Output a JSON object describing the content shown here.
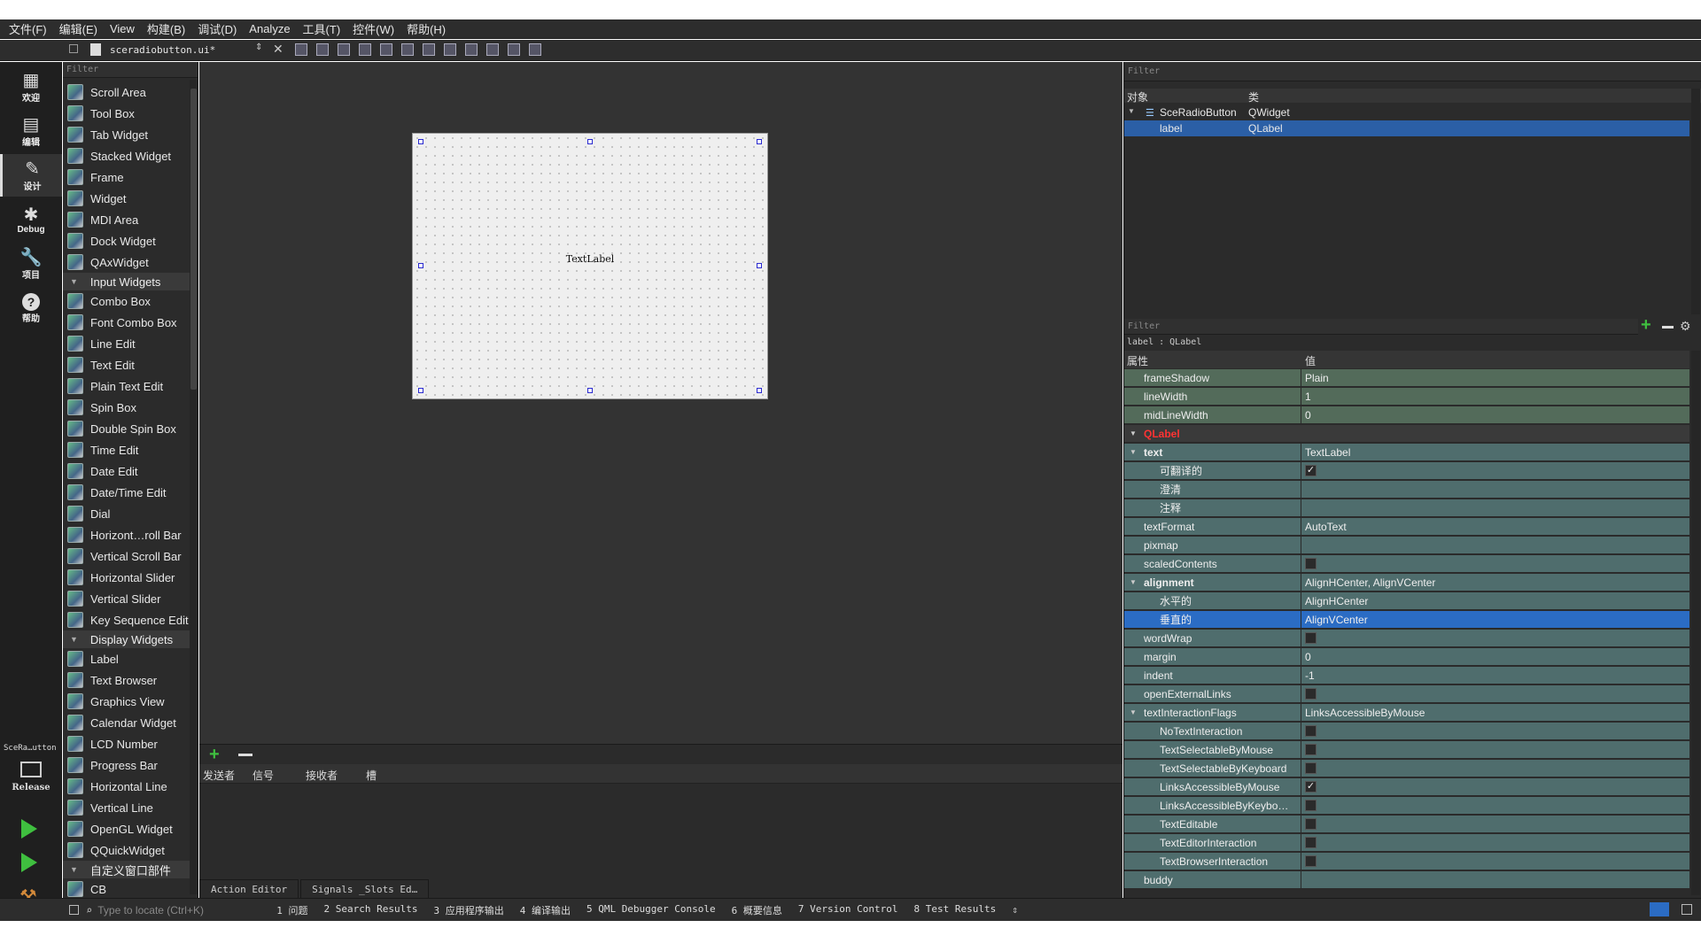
{
  "menu": [
    "文件(F)",
    "编辑(E)",
    "View",
    "构建(B)",
    "调试(D)",
    "Analyze",
    "工具(T)",
    "控件(W)",
    "帮助(H)"
  ],
  "toolbar": {
    "file_name": "sceradiobutton.ui*"
  },
  "modes": [
    {
      "label": "欢迎",
      "icon": "grid-icon"
    },
    {
      "label": "编辑",
      "icon": "edit-icon"
    },
    {
      "label": "设计",
      "icon": "pencil-icon"
    },
    {
      "label": "Debug",
      "icon": "bug-icon"
    },
    {
      "label": "项目",
      "icon": "wrench-icon"
    },
    {
      "label": "帮助",
      "icon": "help-icon"
    }
  ],
  "kit": {
    "name": "SceRa…utton",
    "config": "Release"
  },
  "widgetbox": {
    "filter": "Filter",
    "items": [
      {
        "type": "item",
        "label": "Scroll Area"
      },
      {
        "type": "item",
        "label": "Tool Box"
      },
      {
        "type": "item",
        "label": "Tab Widget"
      },
      {
        "type": "item",
        "label": "Stacked Widget"
      },
      {
        "type": "item",
        "label": "Frame"
      },
      {
        "type": "item",
        "label": "Widget"
      },
      {
        "type": "item",
        "label": "MDI Area"
      },
      {
        "type": "item",
        "label": "Dock Widget"
      },
      {
        "type": "item",
        "label": "QAxWidget"
      },
      {
        "type": "cat",
        "label": "Input Widgets"
      },
      {
        "type": "item",
        "label": "Combo Box"
      },
      {
        "type": "item",
        "label": "Font Combo Box"
      },
      {
        "type": "item",
        "label": "Line Edit"
      },
      {
        "type": "item",
        "label": "Text Edit"
      },
      {
        "type": "item",
        "label": "Plain Text Edit"
      },
      {
        "type": "item",
        "label": "Spin Box"
      },
      {
        "type": "item",
        "label": "Double Spin Box"
      },
      {
        "type": "item",
        "label": "Time Edit"
      },
      {
        "type": "item",
        "label": "Date Edit"
      },
      {
        "type": "item",
        "label": "Date/Time Edit"
      },
      {
        "type": "item",
        "label": "Dial"
      },
      {
        "type": "item",
        "label": "Horizont…roll Bar"
      },
      {
        "type": "item",
        "label": "Vertical Scroll Bar"
      },
      {
        "type": "item",
        "label": "Horizontal Slider"
      },
      {
        "type": "item",
        "label": "Vertical Slider"
      },
      {
        "type": "item",
        "label": "Key Sequence Edit"
      },
      {
        "type": "cat",
        "label": "Display Widgets"
      },
      {
        "type": "item",
        "label": "Label"
      },
      {
        "type": "item",
        "label": "Text Browser"
      },
      {
        "type": "item",
        "label": "Graphics View"
      },
      {
        "type": "item",
        "label": "Calendar Widget"
      },
      {
        "type": "item",
        "label": "LCD Number"
      },
      {
        "type": "item",
        "label": "Progress Bar"
      },
      {
        "type": "item",
        "label": "Horizontal Line"
      },
      {
        "type": "item",
        "label": "Vertical Line"
      },
      {
        "type": "item",
        "label": "OpenGL Widget"
      },
      {
        "type": "item",
        "label": "QQuickWidget"
      },
      {
        "type": "cat",
        "label": "自定义窗口部件"
      },
      {
        "type": "item",
        "label": "CB"
      }
    ]
  },
  "form": {
    "label_text": "TextLabel"
  },
  "signals": {
    "headers": [
      "发送者",
      "信号",
      "接收者",
      "槽"
    ],
    "tabs": [
      "Action Editor",
      "Signals _Slots Ed…"
    ]
  },
  "objects": {
    "filter": "Filter",
    "headers": [
      "对象",
      "类"
    ],
    "rows": [
      {
        "name": "SceRadioButton",
        "cls": "QWidget"
      },
      {
        "name": "label",
        "cls": "QLabel"
      }
    ]
  },
  "properties": {
    "filter": "Filter",
    "context": "label : QLabel",
    "headers": [
      "属性",
      "值"
    ],
    "rows": [
      {
        "name": "frameShadow",
        "value": "Plain",
        "cls": "g"
      },
      {
        "name": "lineWidth",
        "value": "1",
        "cls": "g"
      },
      {
        "name": "midLineWidth",
        "value": "0",
        "cls": "g"
      },
      {
        "name": "QLabel",
        "value": "",
        "cls": "hdr"
      },
      {
        "name": "text",
        "value": "TextLabel",
        "cls": "t",
        "bold": true,
        "expand": true
      },
      {
        "name": "可翻译的",
        "value": "",
        "cls": "t",
        "indent": true,
        "check": "✓"
      },
      {
        "name": "澄清",
        "value": "",
        "cls": "t",
        "indent": true
      },
      {
        "name": "注释",
        "value": "",
        "cls": "t",
        "indent": true
      },
      {
        "name": "textFormat",
        "value": "AutoText",
        "cls": "t"
      },
      {
        "name": "pixmap",
        "value": "",
        "cls": "t"
      },
      {
        "name": "scaledContents",
        "value": "",
        "cls": "t",
        "check": " "
      },
      {
        "name": "alignment",
        "value": "AlignHCenter, AlignVCenter",
        "cls": "t",
        "bold": true,
        "expand": true
      },
      {
        "name": "水平的",
        "value": "AlignHCenter",
        "cls": "t",
        "indent": true
      },
      {
        "name": "垂直的",
        "value": "AlignVCenter",
        "cls": "sel",
        "indent": true
      },
      {
        "name": "wordWrap",
        "value": "",
        "cls": "t",
        "check": " "
      },
      {
        "name": "margin",
        "value": "0",
        "cls": "t"
      },
      {
        "name": "indent",
        "value": "-1",
        "cls": "t"
      },
      {
        "name": "openExternalLinks",
        "value": "",
        "cls": "t",
        "check": " "
      },
      {
        "name": "textInteractionFlags",
        "value": "LinksAccessibleByMouse",
        "cls": "t",
        "expand": true
      },
      {
        "name": "NoTextInteraction",
        "value": "",
        "cls": "t",
        "indent": true,
        "check": " "
      },
      {
        "name": "TextSelectableByMouse",
        "value": "",
        "cls": "t",
        "indent": true,
        "check": " "
      },
      {
        "name": "TextSelectableByKeyboard",
        "value": "",
        "cls": "t",
        "indent": true,
        "check": " "
      },
      {
        "name": "LinksAccessibleByMouse",
        "value": "",
        "cls": "t",
        "indent": true,
        "check": "✓"
      },
      {
        "name": "LinksAccessibleByKeybo…",
        "value": "",
        "cls": "t",
        "indent": true,
        "check": " "
      },
      {
        "name": "TextEditable",
        "value": "",
        "cls": "t",
        "indent": true,
        "check": " "
      },
      {
        "name": "TextEditorInteraction",
        "value": "",
        "cls": "t",
        "indent": true,
        "check": " "
      },
      {
        "name": "TextBrowserInteraction",
        "value": "",
        "cls": "t",
        "indent": true,
        "check": " "
      },
      {
        "name": "buddy",
        "value": "",
        "cls": "t"
      }
    ]
  },
  "status": {
    "locate_placeholder": "Type to locate (Ctrl+K)",
    "panes": [
      "1 问题",
      "2 Search Results",
      "3 应用程序输出",
      "4 编译输出",
      "5 QML Debugger Console",
      "6 概要信息",
      "7 Version Control",
      "8 Test Results"
    ]
  },
  "colors": {
    "accent": "#2b6cc4",
    "qlabel_header": "#ff3333",
    "prop_green": "#536b5a",
    "prop_teal": "#4f6d6d"
  }
}
